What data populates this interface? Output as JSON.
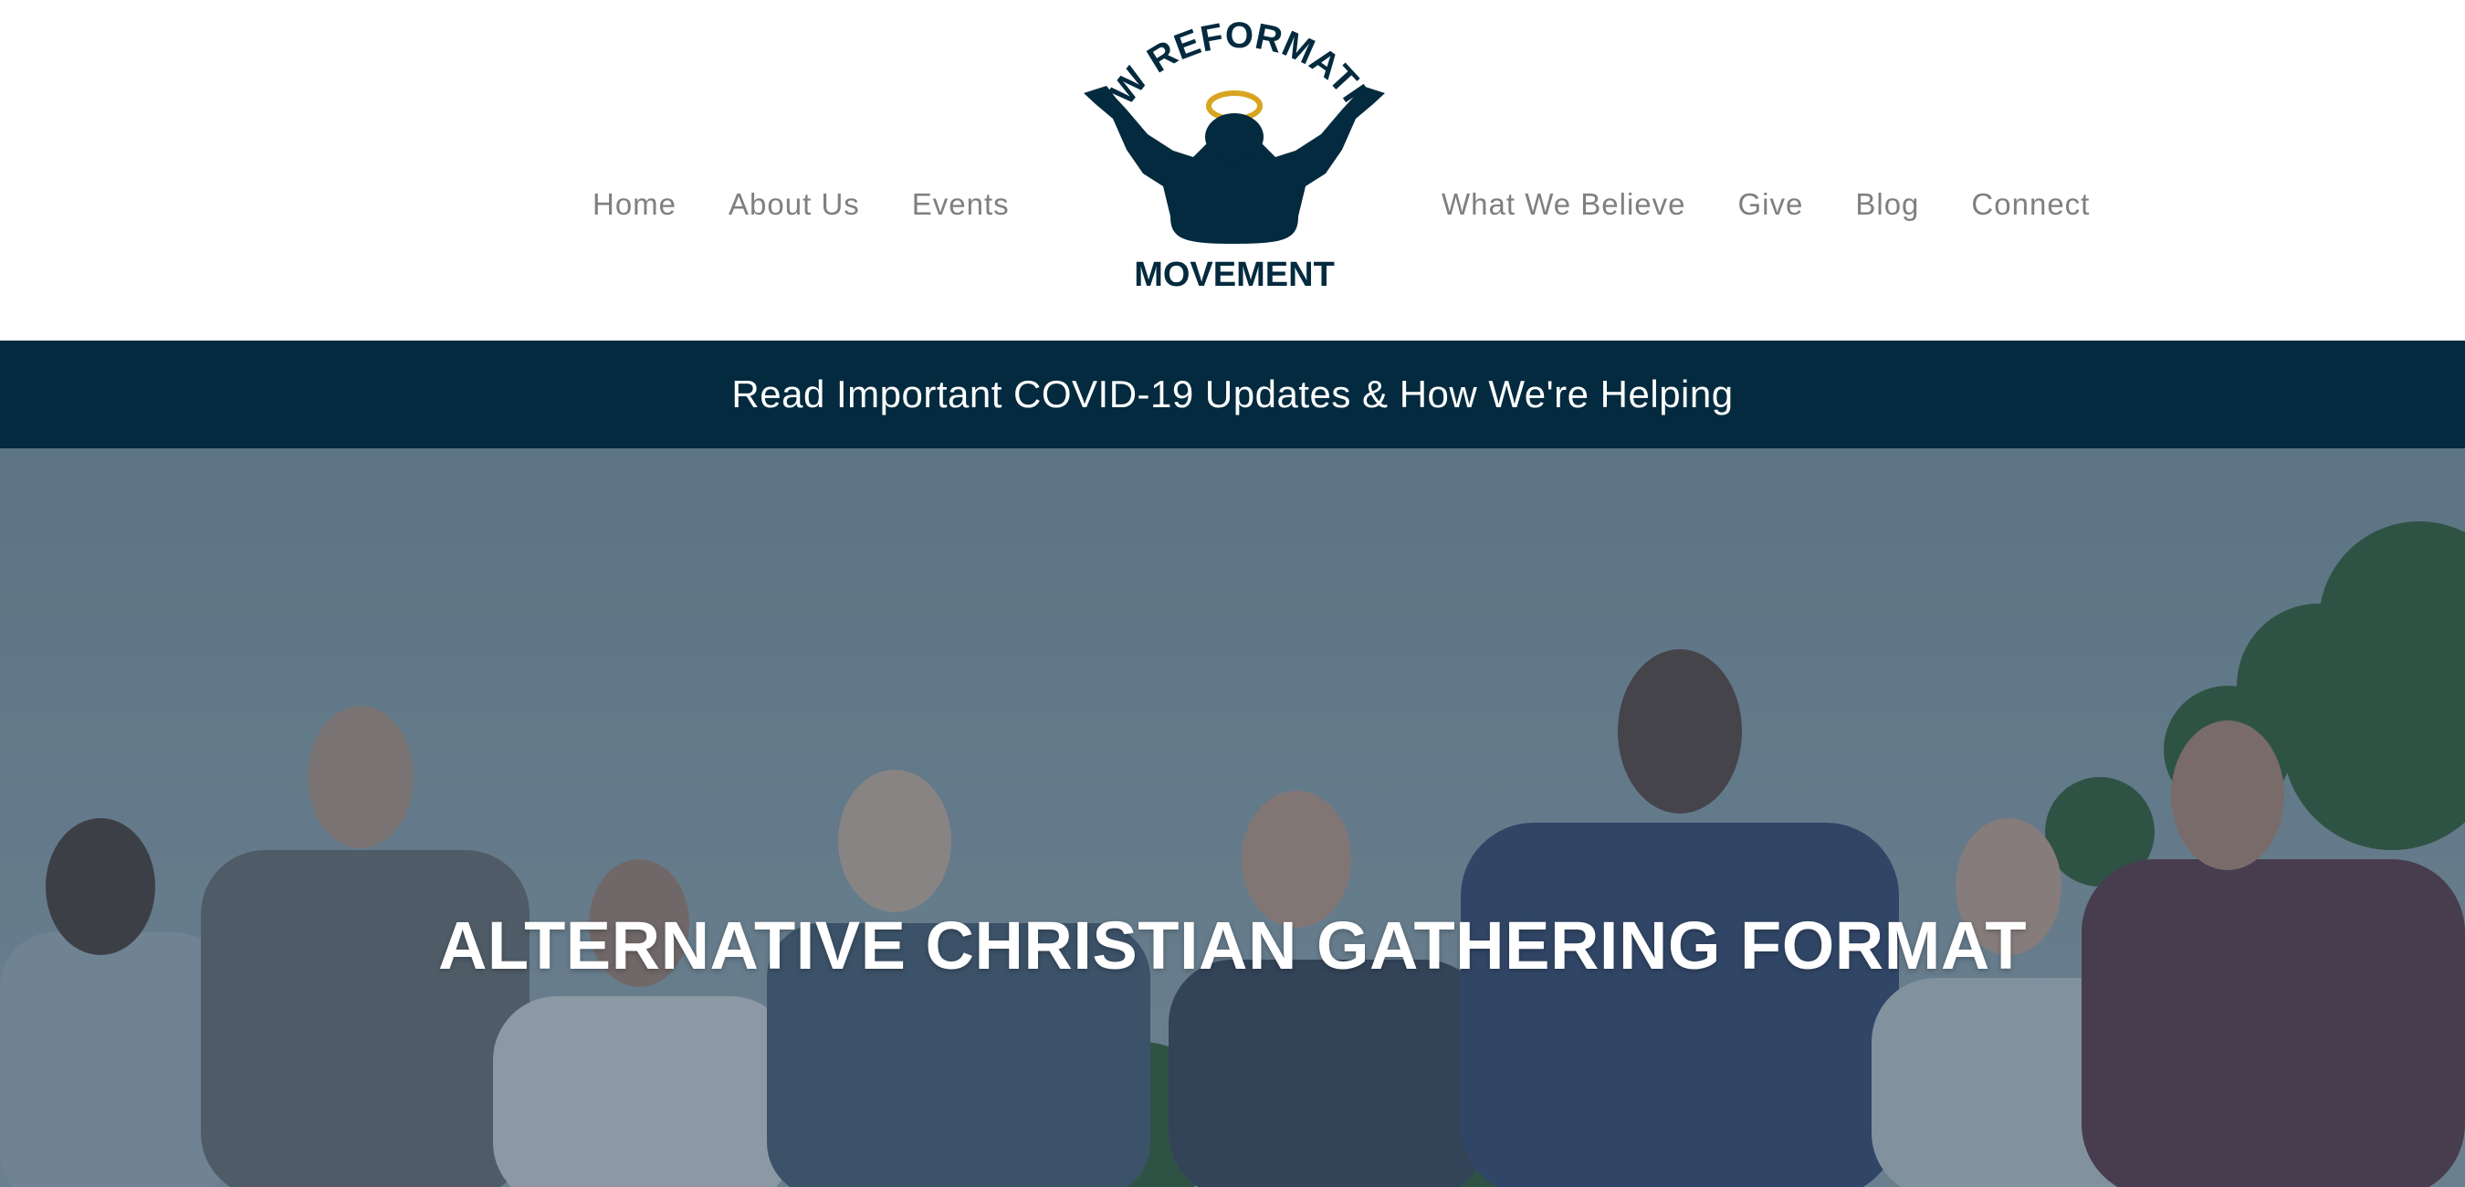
{
  "nav": {
    "left": [
      "Home",
      "About Us",
      "Events"
    ],
    "right": [
      "What We Believe",
      "Give",
      "Blog",
      "Connect"
    ]
  },
  "logo": {
    "arc_text": "NEW REFORMATION",
    "bottom_text": "MOVEMENT"
  },
  "banner": {
    "text": "Read Important COVID-19 Updates & How We're Helping"
  },
  "hero": {
    "title": "ALTERNATIVE CHRISTIAN GATHERING FORMAT",
    "image": "group-of-people-hugging-outdoors"
  },
  "colors": {
    "navy": "#032a3e",
    "halo": "#d9a521",
    "nav_text": "#7f7f7f",
    "hero_overlay": "#3b5a70"
  }
}
